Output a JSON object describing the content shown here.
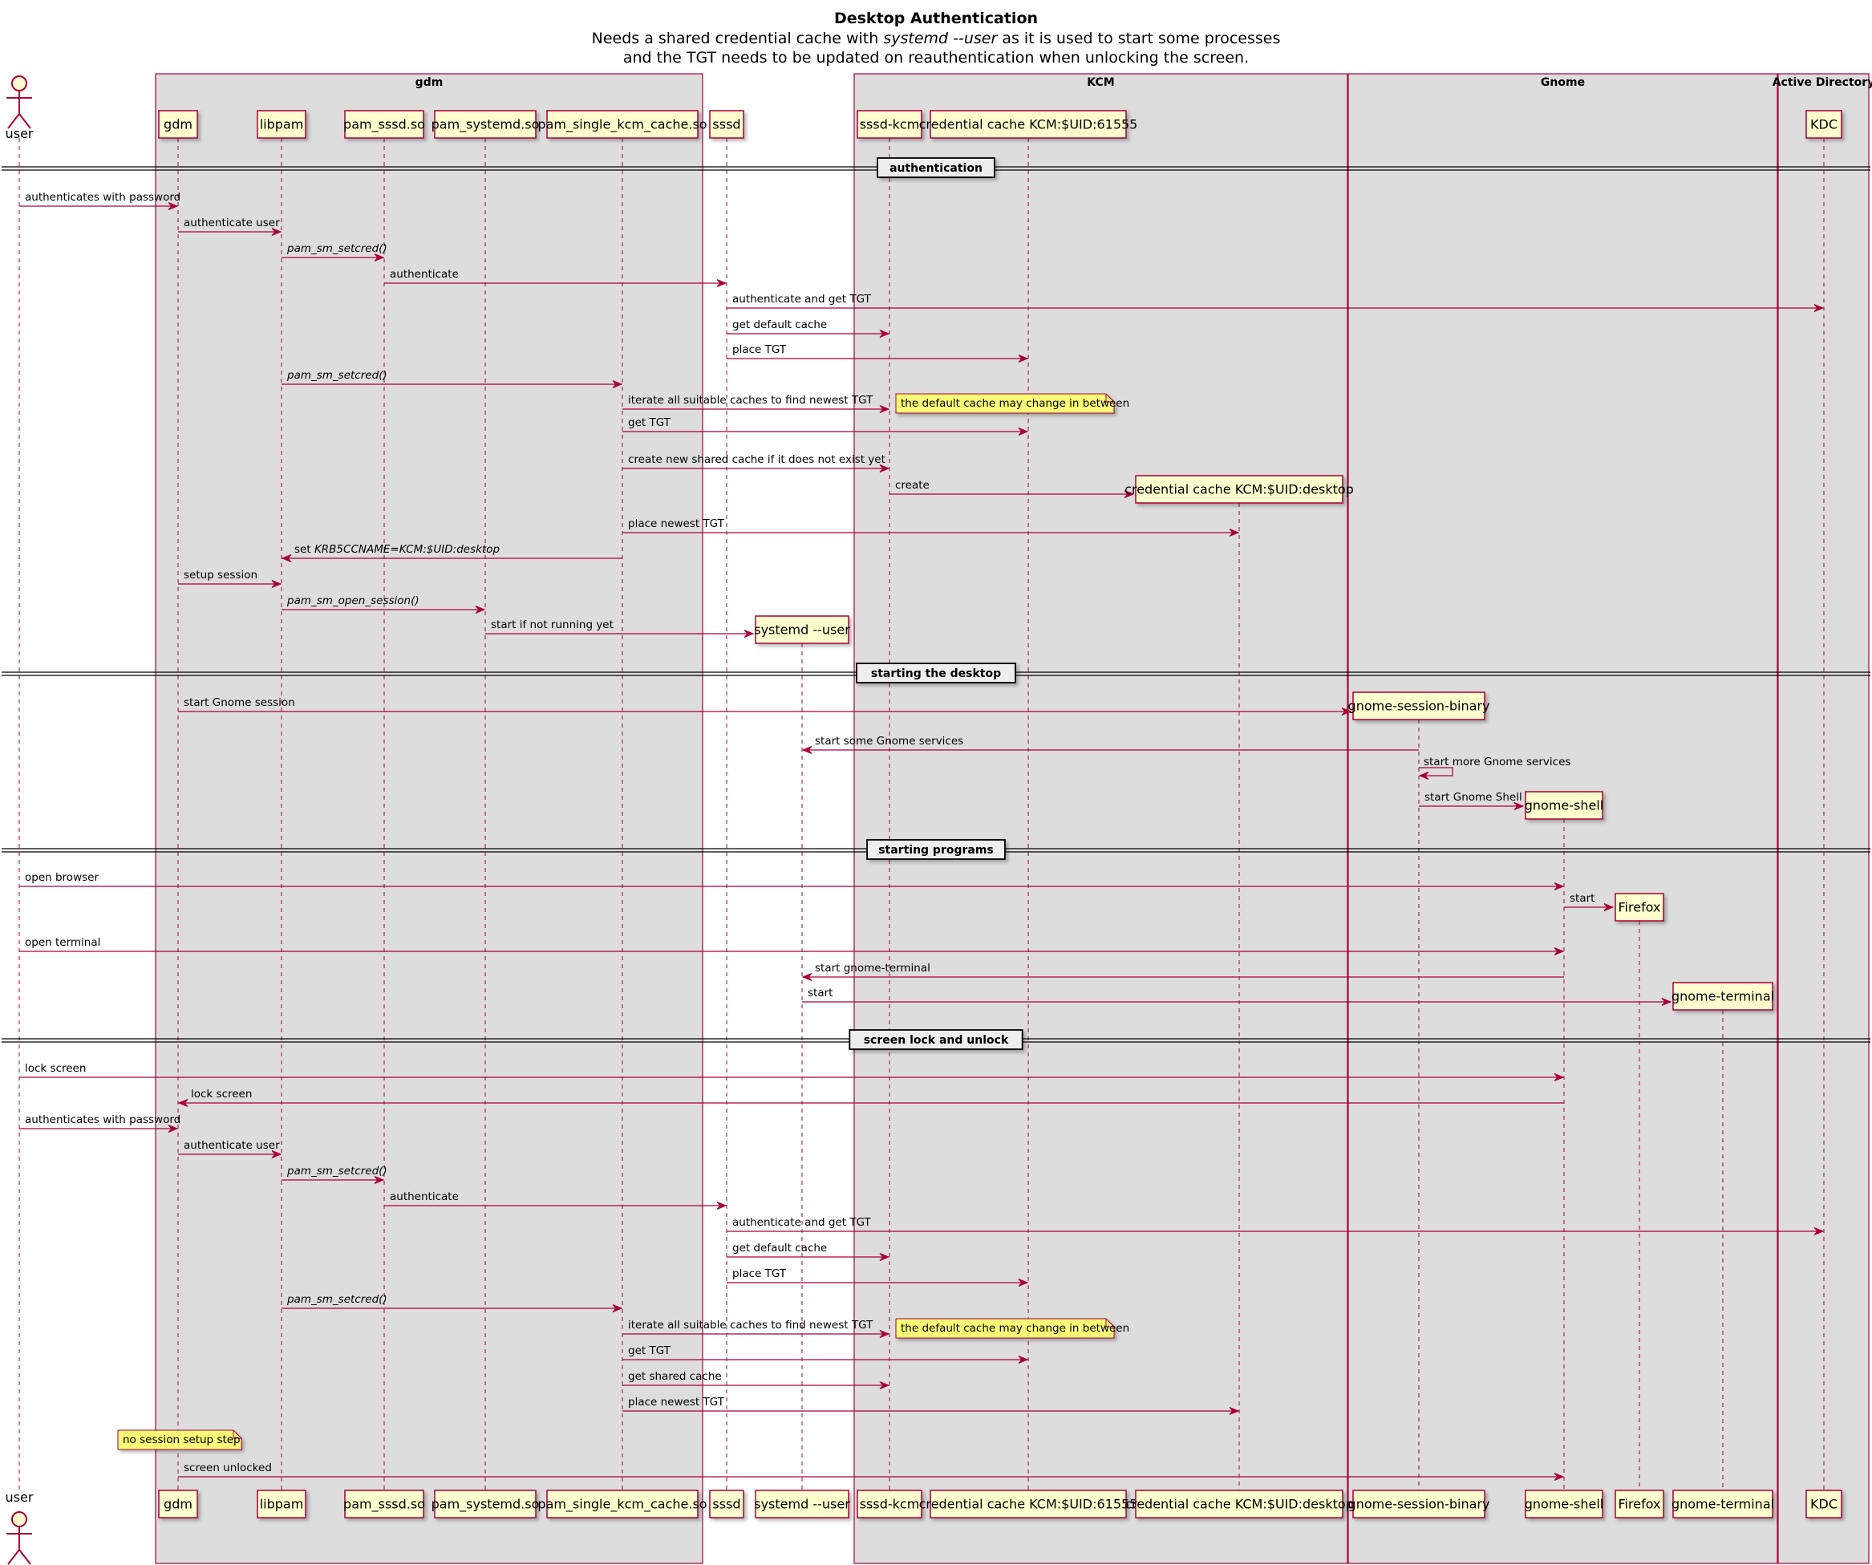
{
  "title": "Desktop Authentication",
  "subtitle": [
    [
      {
        "t": "Needs a shared credential cache with "
      },
      {
        "t": "systemd --user",
        "i": true
      },
      {
        "t": " as it is used to start some processes"
      }
    ],
    [
      {
        "t": "and the TGT needs to be updated on reauthentication when unlocking the screen."
      }
    ]
  ],
  "colors": {
    "line": "#A80036",
    "box_fill": "#DDDDDD",
    "participant_fill": "#FEFECE",
    "note_fill": "#FBFB77",
    "arrow": "#A80036"
  },
  "boxes": [
    {
      "id": "gdm",
      "label": "gdm",
      "from": "gdm",
      "to": "pam_single_kcm_cache"
    },
    {
      "id": "kcm",
      "label": "KCM",
      "from": "sssd_kcm",
      "to": "cc_desktop"
    },
    {
      "id": "gnome",
      "label": "Gnome",
      "from": "gnome_session",
      "to": "gnome_terminal"
    },
    {
      "id": "ad",
      "label": "Active Directory",
      "from": "kdc",
      "to": "kdc"
    }
  ],
  "participants": [
    {
      "id": "user",
      "label": "user",
      "actor": true
    },
    {
      "id": "gdm",
      "label": "gdm"
    },
    {
      "id": "libpam",
      "label": "libpam"
    },
    {
      "id": "pam_sssd",
      "label": "pam_sssd.so"
    },
    {
      "id": "pam_systemd",
      "label": "pam_systemd.so"
    },
    {
      "id": "pam_single_kcm_cache",
      "label": "pam_single_kcm_cache.so"
    },
    {
      "id": "sssd",
      "label": "sssd"
    },
    {
      "id": "systemd_user",
      "label": "systemd --user",
      "created": true
    },
    {
      "id": "sssd_kcm",
      "label": "sssd-kcm"
    },
    {
      "id": "cc_61555",
      "label": "credential cache KCM:$UID:61555"
    },
    {
      "id": "cc_desktop",
      "label": "credential cache KCM:$UID:desktop",
      "created": true
    },
    {
      "id": "gnome_session",
      "label": "gnome-session-binary",
      "created": true
    },
    {
      "id": "gnome_shell",
      "label": "gnome-shell",
      "created": true
    },
    {
      "id": "firefox",
      "label": "Firefox",
      "created": true
    },
    {
      "id": "gnome_terminal",
      "label": "gnome-terminal",
      "created": true
    },
    {
      "id": "kdc",
      "label": "KDC"
    }
  ],
  "sections": [
    {
      "type": "divider",
      "label": "authentication"
    },
    {
      "type": "msg",
      "from": "user",
      "to": "gdm",
      "text": "authenticates with password"
    },
    {
      "type": "msg",
      "from": "gdm",
      "to": "libpam",
      "text": "authenticate user"
    },
    {
      "type": "msg",
      "from": "libpam",
      "to": "pam_sssd",
      "text": "pam_sm_setcred()",
      "italic": true
    },
    {
      "type": "msg",
      "from": "pam_sssd",
      "to": "sssd",
      "text": "authenticate"
    },
    {
      "type": "msg",
      "from": "sssd",
      "to": "kdc",
      "text": "authenticate and get TGT"
    },
    {
      "type": "msg",
      "from": "sssd",
      "to": "sssd_kcm",
      "text": "get default cache"
    },
    {
      "type": "msg",
      "from": "sssd",
      "to": "cc_61555",
      "text": "place TGT"
    },
    {
      "type": "msg",
      "from": "libpam",
      "to": "pam_single_kcm_cache",
      "text": "pam_sm_setcred()",
      "italic": true
    },
    {
      "type": "msg",
      "from": "pam_single_kcm_cache",
      "to": "sssd_kcm",
      "text": "iterate all suitable caches to find newest TGT",
      "note": "the default cache may change in between"
    },
    {
      "type": "msg",
      "from": "pam_single_kcm_cache",
      "to": "cc_61555",
      "text": "get TGT"
    },
    {
      "type": "msg",
      "from": "pam_single_kcm_cache",
      "to": "sssd_kcm",
      "text": "create new shared cache if it does not exist yet"
    },
    {
      "type": "msg",
      "from": "sssd_kcm",
      "to": "cc_desktop",
      "text": "create",
      "create": true
    },
    {
      "type": "msg",
      "from": "pam_single_kcm_cache",
      "to": "cc_desktop",
      "text": "place newest TGT"
    },
    {
      "type": "msg",
      "from": "pam_single_kcm_cache",
      "to": "libpam",
      "text": "set KRB5CCNAME=KCM:$UID:desktop",
      "parts": [
        {
          "t": "set "
        },
        {
          "t": "KRB5CCNAME=KCM:$UID:desktop",
          "i": true
        }
      ]
    },
    {
      "type": "msg",
      "from": "gdm",
      "to": "libpam",
      "text": "setup session"
    },
    {
      "type": "msg",
      "from": "libpam",
      "to": "pam_systemd",
      "text": "pam_sm_open_session()",
      "italic": true
    },
    {
      "type": "msg",
      "from": "pam_systemd",
      "to": "systemd_user",
      "text": "start if not running yet",
      "create": true
    },
    {
      "type": "divider",
      "label": "starting the desktop"
    },
    {
      "type": "msg",
      "from": "gdm",
      "to": "gnome_session",
      "text": "start Gnome session",
      "create": true
    },
    {
      "type": "msg",
      "from": "gnome_session",
      "to": "systemd_user",
      "text": "start some Gnome services"
    },
    {
      "type": "self",
      "from": "gnome_session",
      "text": "start more Gnome services"
    },
    {
      "type": "msg",
      "from": "gnome_session",
      "to": "gnome_shell",
      "text": "start Gnome Shell",
      "create": true
    },
    {
      "type": "divider",
      "label": "starting programs"
    },
    {
      "type": "msg",
      "from": "user",
      "to": "gnome_shell",
      "text": "open browser"
    },
    {
      "type": "msg",
      "from": "gnome_shell",
      "to": "firefox",
      "text": "start",
      "create": true
    },
    {
      "type": "msg",
      "from": "user",
      "to": "gnome_shell",
      "text": "open terminal"
    },
    {
      "type": "msg",
      "from": "gnome_shell",
      "to": "systemd_user",
      "text": "start gnome-terminal"
    },
    {
      "type": "msg",
      "from": "systemd_user",
      "to": "gnome_terminal",
      "text": "start",
      "create": true
    },
    {
      "type": "divider",
      "label": "screen lock and unlock"
    },
    {
      "type": "msg",
      "from": "user",
      "to": "gnome_shell",
      "text": "lock screen"
    },
    {
      "type": "msg",
      "from": "gnome_shell",
      "to": "gdm",
      "text": "lock screen"
    },
    {
      "type": "msg",
      "from": "user",
      "to": "gdm",
      "text": "authenticates with password"
    },
    {
      "type": "msg",
      "from": "gdm",
      "to": "libpam",
      "text": "authenticate user"
    },
    {
      "type": "msg",
      "from": "libpam",
      "to": "pam_sssd",
      "text": "pam_sm_setcred()",
      "italic": true
    },
    {
      "type": "msg",
      "from": "pam_sssd",
      "to": "sssd",
      "text": "authenticate"
    },
    {
      "type": "msg",
      "from": "sssd",
      "to": "kdc",
      "text": "authenticate and get TGT"
    },
    {
      "type": "msg",
      "from": "sssd",
      "to": "sssd_kcm",
      "text": "get default cache"
    },
    {
      "type": "msg",
      "from": "sssd",
      "to": "cc_61555",
      "text": "place TGT"
    },
    {
      "type": "msg",
      "from": "libpam",
      "to": "pam_single_kcm_cache",
      "text": "pam_sm_setcred()",
      "italic": true
    },
    {
      "type": "msg",
      "from": "pam_single_kcm_cache",
      "to": "sssd_kcm",
      "text": "iterate all suitable caches to find newest TGT",
      "note": "the default cache may change in between"
    },
    {
      "type": "msg",
      "from": "pam_single_kcm_cache",
      "to": "cc_61555",
      "text": "get TGT"
    },
    {
      "type": "msg",
      "from": "pam_single_kcm_cache",
      "to": "sssd_kcm",
      "text": "get shared cache"
    },
    {
      "type": "msg",
      "from": "pam_single_kcm_cache",
      "to": "cc_desktop",
      "text": "place newest TGT"
    },
    {
      "type": "note_left",
      "over": "gdm",
      "text": "no session setup step"
    },
    {
      "type": "msg",
      "from": "gdm",
      "to": "gnome_shell",
      "text": "screen unlocked"
    }
  ]
}
